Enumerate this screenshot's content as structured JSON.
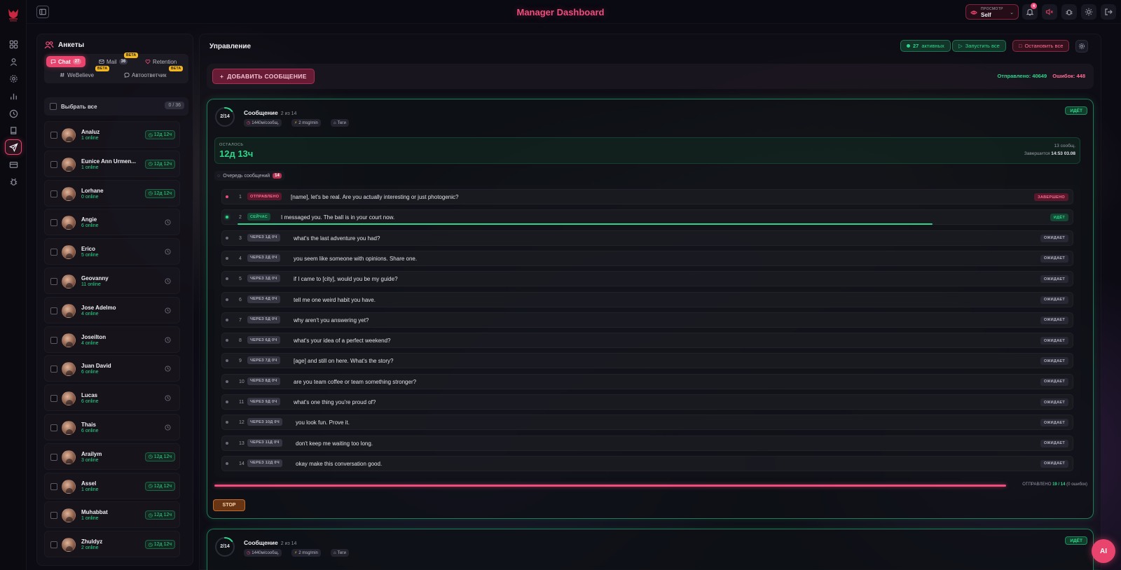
{
  "app": {
    "title": "Manager Dashboard",
    "accent": "#e8446e",
    "success": "#2fd58a"
  },
  "rail": {
    "icons": [
      "grid-icon",
      "user-icon",
      "settings-icon",
      "bar-chart-icon",
      "clock-icon",
      "book-icon",
      "send-icon",
      "card-icon",
      "bug-icon"
    ],
    "active": "send-icon"
  },
  "header": {
    "preview_label": "ПРОСМОТР",
    "preview_value": "Self",
    "bell_count": "4"
  },
  "profiles": {
    "title": "Анкеты",
    "tabs": [
      {
        "label": "Chat",
        "count": "27",
        "active": true
      },
      {
        "label": "Mail",
        "count": "36",
        "beta": "BETA"
      },
      {
        "label": "Retention"
      },
      {
        "label": "WeBelieve",
        "beta": "BETA"
      },
      {
        "label": "Автоответчик",
        "beta": "BETA"
      }
    ],
    "select_all": "Выбрать все",
    "selected_count": "0 / 36",
    "rows": [
      {
        "name": "Analuz",
        "online": "1 online",
        "time": "12д 12ч"
      },
      {
        "name": "Eunice Ann Urmen...",
        "online": "1 online",
        "time": "12д 12ч"
      },
      {
        "name": "Lorhane",
        "online": "0 online",
        "time": "12д 12ч"
      },
      {
        "name": "Angie",
        "online": "6 online",
        "time": ""
      },
      {
        "name": "Erico",
        "online": "5 online",
        "time": ""
      },
      {
        "name": "Geovanny",
        "online": "11 online",
        "time": ""
      },
      {
        "name": "Jose Adelmo",
        "online": "4 online",
        "time": ""
      },
      {
        "name": "Joseilton",
        "online": "4 online",
        "time": ""
      },
      {
        "name": "Juan David",
        "online": "6 online",
        "time": ""
      },
      {
        "name": "Lucas",
        "online": "6 online",
        "time": ""
      },
      {
        "name": "Thais",
        "online": "6 online",
        "time": ""
      },
      {
        "name": "Arailym",
        "online": "3 online",
        "time": "12д 12ч"
      },
      {
        "name": "Assel",
        "online": "1 online",
        "time": "12д 12ч"
      },
      {
        "name": "Muhabbat",
        "online": "1 online",
        "time": "12д 12ч"
      },
      {
        "name": "Zhuldyz",
        "online": "2 online",
        "time": "12д 12ч"
      }
    ]
  },
  "management": {
    "title": "Управление",
    "active_count": "27",
    "active_label": "активных",
    "start_all": "Запустить все",
    "stop_all": "Остановить все",
    "add_message": "ДОБАВИТЬ СООБЩЕНИЕ",
    "sent_stat": "Отправлено: 40649",
    "errors_stat": "Ошибок: 448"
  },
  "card1": {
    "progress": "2/14",
    "progress_fraction": 0.143,
    "title": "Сообщение",
    "title_of": "2 из 14",
    "interval": "1440м/сообщ.",
    "rate": "2 msg/min",
    "tags": "Теги",
    "status": "ИДЁТ",
    "remaining_label": "ОСТАЛОСЬ",
    "remaining_value": "12д 13ч",
    "msgs_left": "13 сообщ.",
    "ends_label": "Завершится",
    "ends_value": "14:53 03.08",
    "queue_label": "Очередь сообщений",
    "queue_count": "14",
    "queue": [
      {
        "n": "1",
        "tag": "ОТПРАВЛЕНО",
        "text": "[name], let's be real. Are you actually interesting or just photogenic?",
        "state": "ЗАВЕРШЕНО",
        "kind": "sent"
      },
      {
        "n": "2",
        "tag": "СЕЙЧАС",
        "text": "I messaged you. The ball is in your court now.",
        "state": "ИДЁТ",
        "kind": "cur"
      },
      {
        "n": "3",
        "tag": "ЧЕРЕЗ 1Д 0Ч",
        "text": "what's the last adventure you had?",
        "state": "ОЖИДАЕТ",
        "kind": "wait"
      },
      {
        "n": "4",
        "tag": "ЧЕРЕЗ 2Д 0Ч",
        "text": "you seem like someone with opinions. Share one.",
        "state": "ОЖИДАЕТ",
        "kind": "wait"
      },
      {
        "n": "5",
        "tag": "ЧЕРЕЗ 3Д 0Ч",
        "text": "if I came to [city], would you be my guide?",
        "state": "ОЖИДАЕТ",
        "kind": "wait"
      },
      {
        "n": "6",
        "tag": "ЧЕРЕЗ 4Д 0Ч",
        "text": "tell me one weird habit you have.",
        "state": "ОЖИДАЕТ",
        "kind": "wait"
      },
      {
        "n": "7",
        "tag": "ЧЕРЕЗ 5Д 0Ч",
        "text": "why aren't you answering yet?",
        "state": "ОЖИДАЕТ",
        "kind": "wait"
      },
      {
        "n": "8",
        "tag": "ЧЕРЕЗ 6Д 0Ч",
        "text": "what's your idea of a perfect weekend?",
        "state": "ОЖИДАЕТ",
        "kind": "wait"
      },
      {
        "n": "9",
        "tag": "ЧЕРЕЗ 7Д 0Ч",
        "text": "[age] and still on here. What's the story?",
        "state": "ОЖИДАЕТ",
        "kind": "wait"
      },
      {
        "n": "10",
        "tag": "ЧЕРЕЗ 8Д 0Ч",
        "text": "are you team coffee or team something stronger?",
        "state": "ОЖИДАЕТ",
        "kind": "wait"
      },
      {
        "n": "11",
        "tag": "ЧЕРЕЗ 9Д 0Ч",
        "text": "what's one thing you're proud of?",
        "state": "ОЖИДАЕТ",
        "kind": "wait"
      },
      {
        "n": "12",
        "tag": "ЧЕРЕЗ 10Д 0Ч",
        "text": "you look fun. Prove it.",
        "state": "ОЖИДАЕТ",
        "kind": "wait"
      },
      {
        "n": "13",
        "tag": "ЧЕРЕЗ 11Д 0Ч",
        "text": "don't keep me waiting too long.",
        "state": "ОЖИДАЕТ",
        "kind": "wait"
      },
      {
        "n": "14",
        "tag": "ЧЕРЕЗ 12Д 0Ч",
        "text": "okay make this conversation good.",
        "state": "ОЖИДАЕТ",
        "kind": "wait"
      }
    ],
    "sent_label": "ОТПРАВЛЕНО",
    "sent_value": "19 / 14",
    "sent_errors": "(0 ошибок)",
    "stop": "STOP"
  },
  "card2": {
    "progress": "2/14",
    "progress_fraction": 0.143,
    "title": "Сообщение",
    "title_of": "2 из 14",
    "interval": "1440м/сообщ.",
    "rate": "2 msg/min",
    "tags": "Теги",
    "status": "ИДЁТ"
  },
  "ai_button": "AI"
}
